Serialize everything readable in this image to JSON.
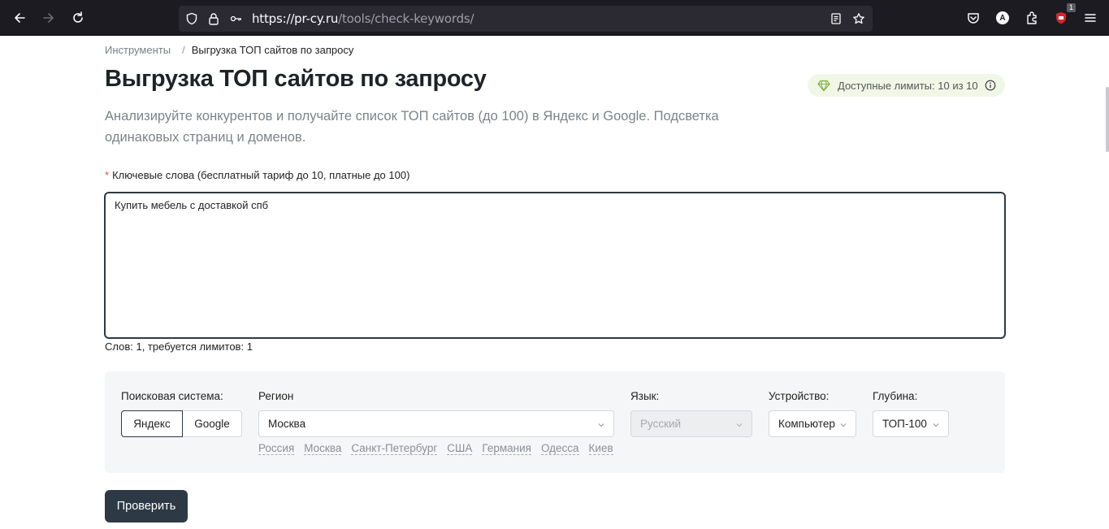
{
  "browser": {
    "url_host": "https://pr-cy.ru",
    "url_path": "/tools/check-keywords/",
    "extension_badge": "1",
    "account_initial": "A"
  },
  "breadcrumb": {
    "parent": "Инструменты",
    "separator": "/",
    "current": "Выгрузка ТОП сайтов по запросу"
  },
  "page": {
    "title": "Выгрузка ТОП сайтов по запросу",
    "limits": "Доступные лимиты: 10 из 10",
    "description": "Анализируйте конкурентов и получайте список ТОП сайтов (до 100) в Яндекс и Google. Подсветка одинаковых страниц и доменов."
  },
  "keywords": {
    "required_mark": "*",
    "label": "Ключевые слова (бесплатный тариф до 10, платные до 100)",
    "value": "Купить мебель с доставкой спб",
    "count_text": "Слов: 1, требуется лимитов: 1"
  },
  "settings": {
    "engine_label": "Поисковая система:",
    "engines": [
      "Яндекс",
      "Google"
    ],
    "engine_selected": "Яндекс",
    "region_label": "Регион",
    "region_value": "Москва",
    "region_quick": [
      "Россия",
      "Москва",
      "Санкт-Петербург",
      "США",
      "Германия",
      "Одесса",
      "Киев"
    ],
    "language_label": "Язык:",
    "language_value": "Русский",
    "device_label": "Устройство:",
    "device_value": "Компьютер",
    "depth_label": "Глубина:",
    "depth_value": "ТОП-100"
  },
  "submit_label": "Проверить",
  "colors": {
    "browser_bg": "#1c1b22",
    "primary_button": "#2d3a45",
    "limits_bg": "#f1f7e7",
    "required": "#e0502e"
  }
}
